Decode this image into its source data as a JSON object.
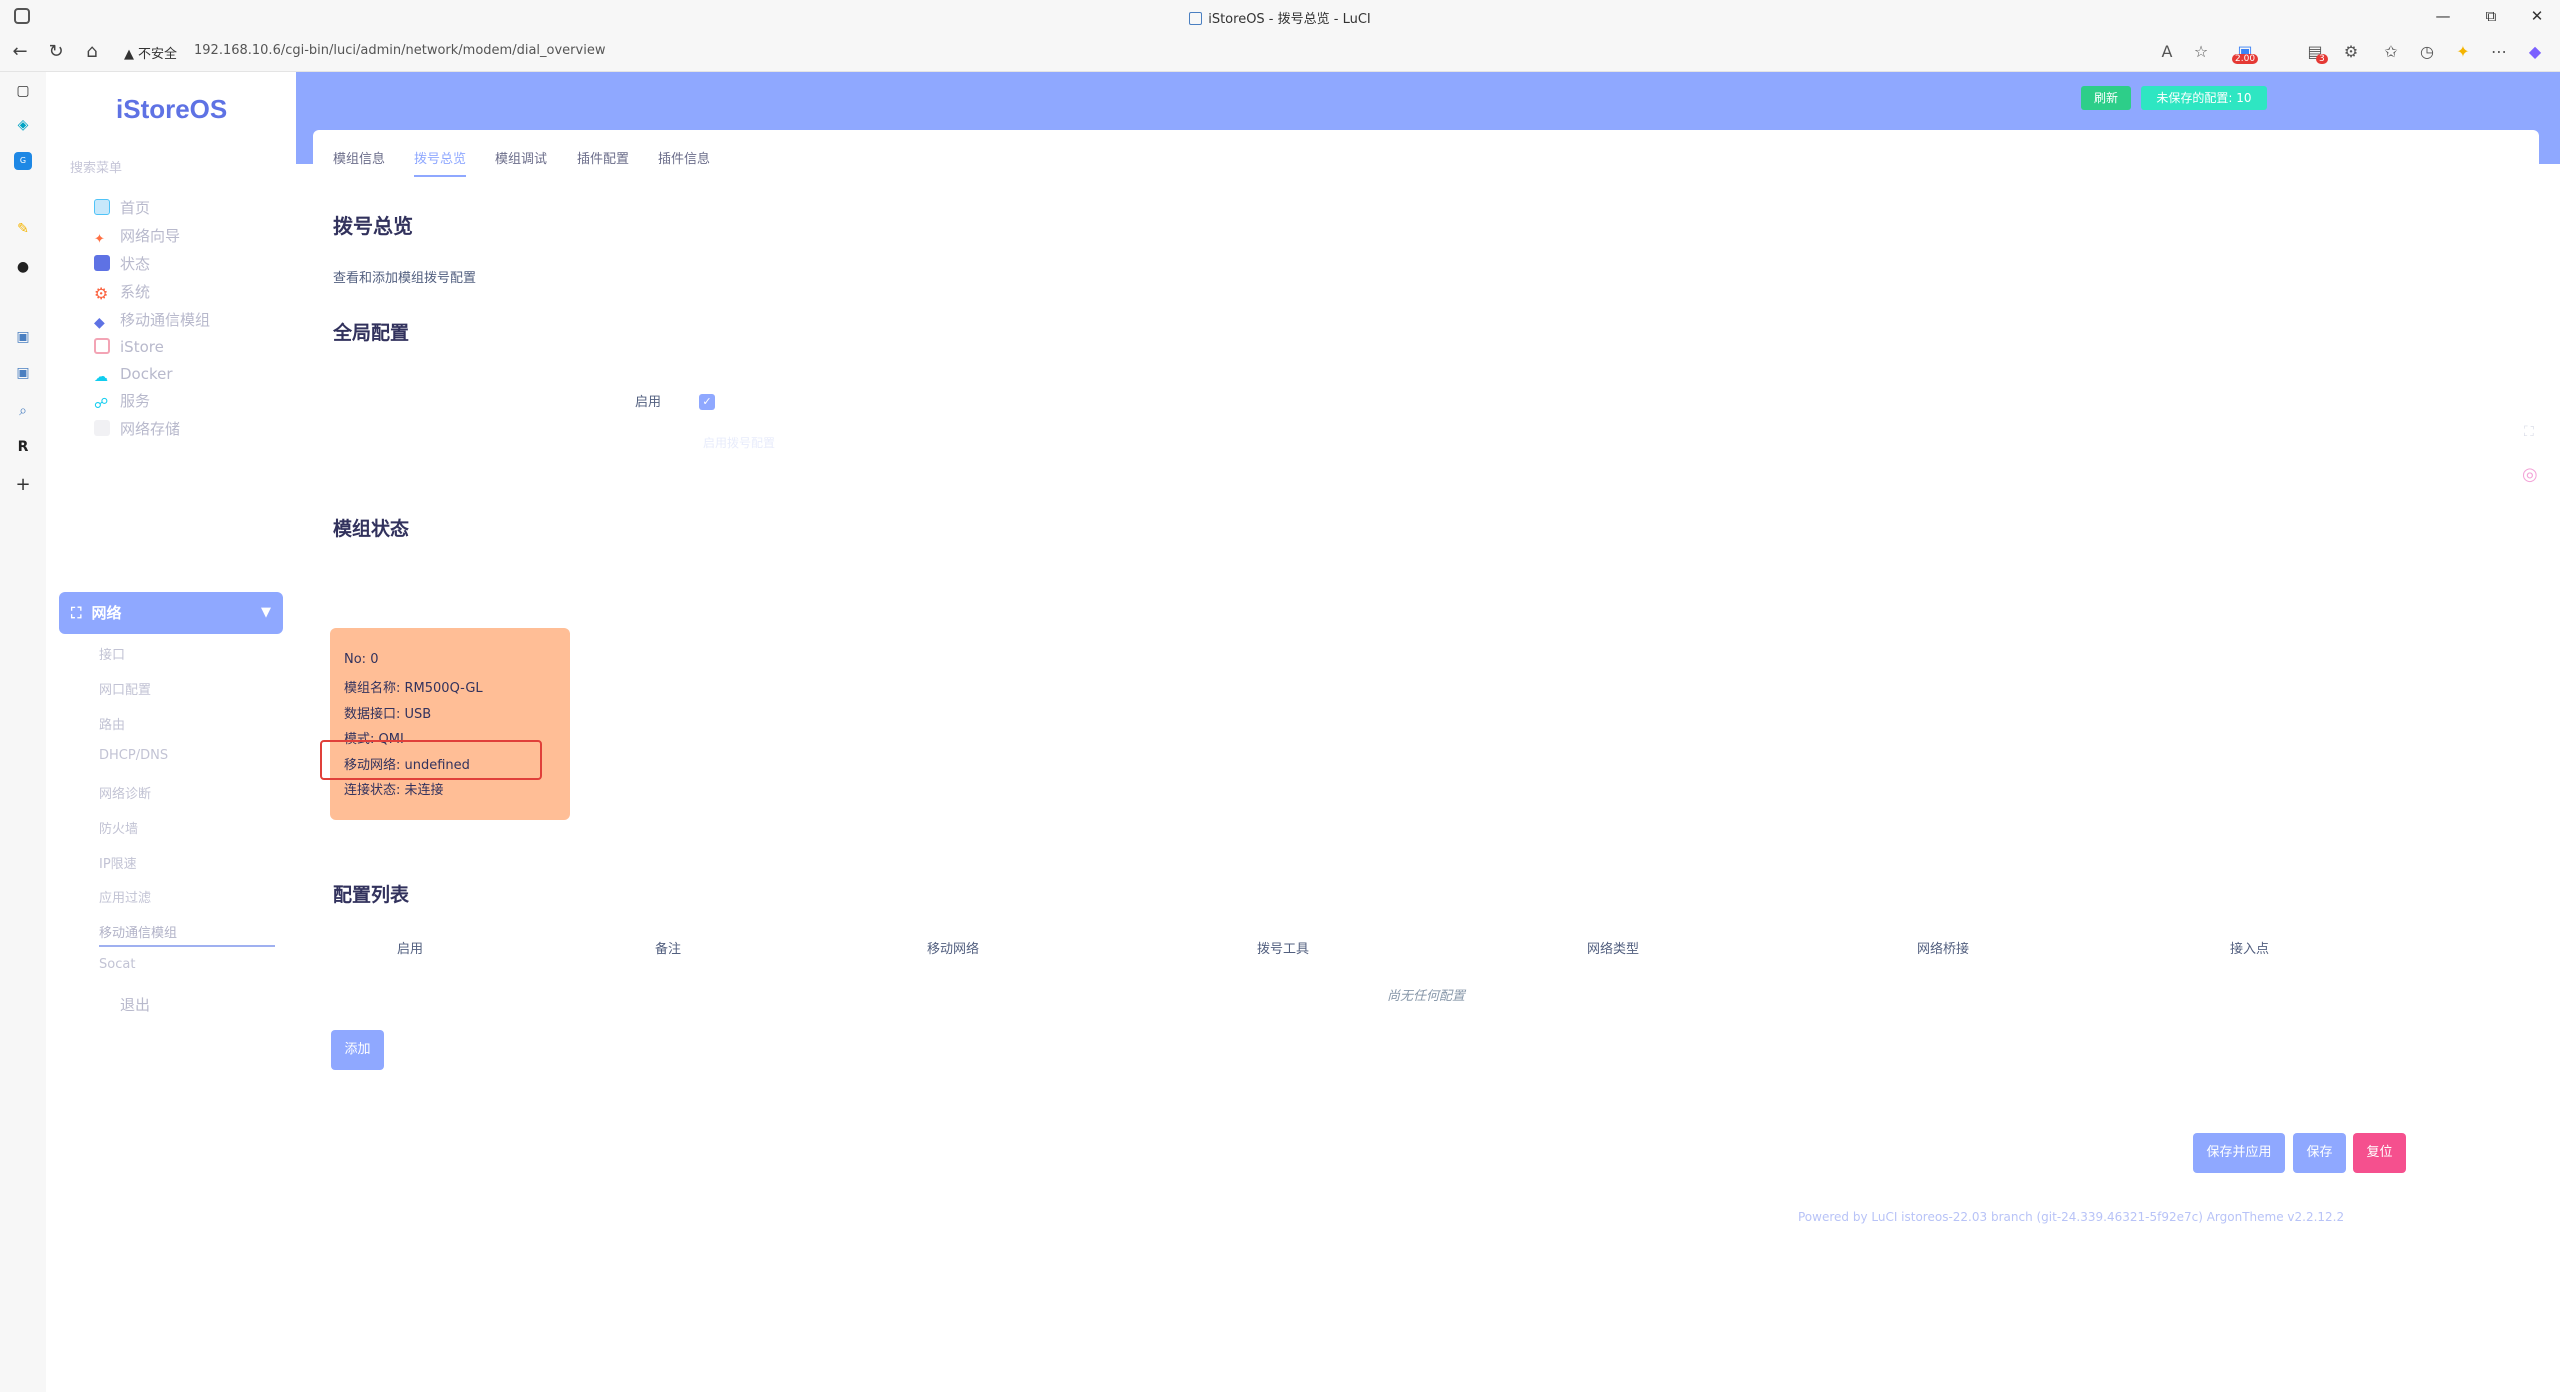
{
  "window": {
    "title": "iStoreOS - 拨号总览 - LuCI",
    "minimize": "—",
    "maximize": "⧉",
    "close": "✕"
  },
  "address": {
    "security": "不安全",
    "url": "192.168.10.6/cgi-bin/luci/admin/network/modem/dial_overview",
    "ext_badge": "2.00",
    "notif_badge": "3"
  },
  "sidebar": {
    "brand": "iStoreOS",
    "search_hint": "搜索菜单",
    "items": [
      {
        "label": "首页",
        "icon": "home-icon",
        "color": "#4fc3f7"
      },
      {
        "label": "网络向导",
        "icon": "wizard-icon",
        "color": "#ff7043"
      },
      {
        "label": "状态",
        "icon": "dashboard-icon",
        "color": "#5e72e4"
      },
      {
        "label": "系统",
        "icon": "gear-icon",
        "color": "#fb6340"
      },
      {
        "label": "移动通信模组",
        "icon": "cube-icon",
        "color": "#5e72e4"
      },
      {
        "label": "iStore",
        "icon": "store-icon",
        "color": "#f3a4b5"
      },
      {
        "label": "Docker",
        "icon": "docker-icon",
        "color": "#11cdef"
      },
      {
        "label": "服务",
        "icon": "services-icon",
        "color": "#11cdef"
      },
      {
        "label": "网络存储",
        "icon": "storage-icon",
        "color": "#dddddd"
      }
    ],
    "active": {
      "label": "网络",
      "icon": "network-icon"
    },
    "sub_items": [
      "接口",
      "网口配置",
      "路由",
      "DHCP/DNS",
      "网络诊断",
      "防火墙",
      "IP限速",
      "应用过滤",
      "移动通信模组",
      "Socat"
    ],
    "current_sub": "移动通信模组",
    "logout": "退出"
  },
  "header": {
    "refresh": "刷新",
    "unsaved": "未保存的配置: 10"
  },
  "tabs": [
    "模组信息",
    "拨号总览",
    "模组调试",
    "插件配置",
    "插件信息"
  ],
  "active_tab": "拨号总览",
  "content": {
    "title": "拨号总览",
    "description": "查看和添加模组拨号配置",
    "global_title": "全局配置",
    "enable_label": "启用",
    "enable_checked": true,
    "enable_hint": "启用拨号配置",
    "status_title": "模组状态",
    "status": {
      "no": "No: 0",
      "name": "模组名称: RM500Q-GL",
      "port": "数据接口: USB",
      "mode": "模式: QMI",
      "network": "移动网络: undefined",
      "connection": "连接状态: 未连接"
    },
    "status_color": "#ffbe96",
    "highlight_color": "#e0403a",
    "list_title": "配置列表",
    "columns": [
      "启用",
      "备注",
      "移动网络",
      "拨号工具",
      "网络类型",
      "网络桥接",
      "接入点"
    ],
    "empty": "尚无任何配置",
    "add": "添加"
  },
  "actions": {
    "save_apply": "保存并应用",
    "save": "保存",
    "reset": "复位"
  },
  "footer": "Powered by LuCI istoreos-22.03 branch (git-24.339.46321-5f92e7c)  ArgonTheme v2.2.12.2",
  "colors": {
    "accent": "#8fa8ff",
    "success": "#2dce89",
    "danger": "#f5508e"
  }
}
